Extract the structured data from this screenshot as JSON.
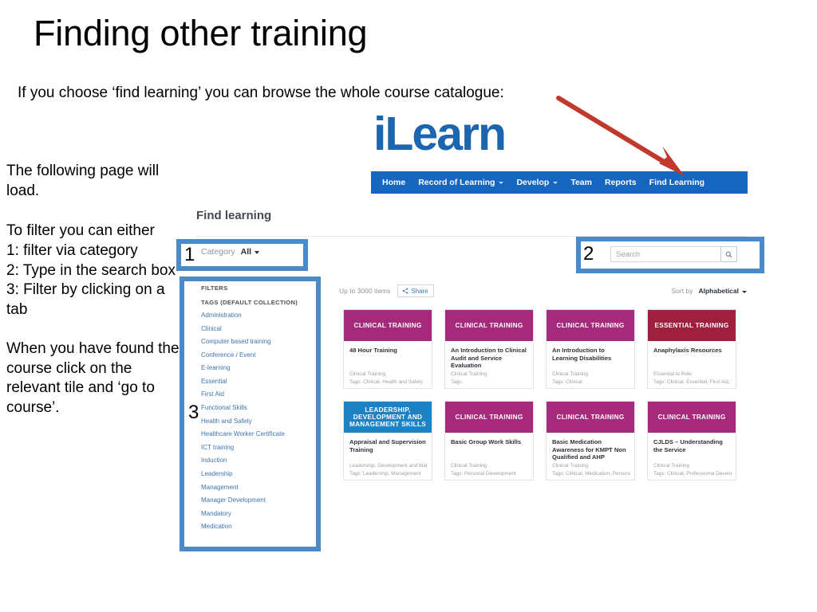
{
  "slide": {
    "title": "Finding other training",
    "intro": "If you choose ‘find learning’ you can browse the whole course catalogue:",
    "left_column": {
      "line1": "The following page will load.",
      "line2": "To filter you can either",
      "line3": "1: filter via category",
      "line4": "2: Type in the search box",
      "line5": "3: Filter by clicking on a tab",
      "line6": "When you have found the course click on the relevant tile and ‘go to course’."
    },
    "callouts": {
      "one": "1",
      "two": "2",
      "three": "3"
    },
    "highlight_color": "#4a89ca",
    "arrow_color": "#c0392b"
  },
  "ilearn": {
    "logo": "iLearn",
    "logo_color": "#1c66b0",
    "nav_bar_color": "#1665bf",
    "nav": [
      {
        "label": "Home",
        "caret": false
      },
      {
        "label": "Record of Learning",
        "caret": true
      },
      {
        "label": "Develop",
        "caret": true
      },
      {
        "label": "Team",
        "caret": false
      },
      {
        "label": "Reports",
        "caret": false
      },
      {
        "label": "Find Learning",
        "caret": false
      }
    ]
  },
  "find_learning": {
    "page_title": "Find learning",
    "category": {
      "label": "Category",
      "value": "All"
    },
    "search": {
      "placeholder": "Search",
      "value": "",
      "icon": "search-icon"
    },
    "filters": {
      "heading": "FILTERS",
      "subheading": "TAGS  (DEFAULT COLLECTION)",
      "tags": [
        "Administration",
        "Clinical",
        "Computer based training",
        "Conference / Event",
        "E-learning",
        "Essential",
        "First Aid",
        "Functional Skills",
        "Health and Safety",
        "Healthcare Worker Certificate",
        "ICT training",
        "Induction",
        "Leadership",
        "Management",
        "Manager Development",
        "Mandatory",
        "Medication"
      ]
    },
    "results_toolbar": {
      "items_count": "Up to 3000 items",
      "share_label": "Share",
      "share_icon": "share-icon",
      "sort_label": "Sort by",
      "sort_value": "Alphabetical"
    },
    "banner_colors": {
      "clinical": "#a62a7b",
      "essential": "#9e1f3e",
      "leadership": "#1c82c4"
    },
    "cards": [
      {
        "banner": "CLINICAL TRAINING",
        "banner_color": "#a62a7b",
        "title": "48 Hour Training",
        "meta": "Clinical Training",
        "tags": "Tags: Clinical, Health and Safety"
      },
      {
        "banner": "CLINICAL TRAINING",
        "banner_color": "#a62a7b",
        "title": "An Introduction to Clinical Audit and Service Evaluation",
        "meta": "Clinical Training",
        "tags": "Tags:"
      },
      {
        "banner": "CLINICAL TRAINING",
        "banner_color": "#a62a7b",
        "title": "An Introduction to Learning Disabilities",
        "meta": "Clinical Training",
        "tags": "Tags: Clinical"
      },
      {
        "banner": "ESSENTIAL TRAINING",
        "banner_color": "#9e1f3e",
        "title": "Anaphylaxis Resources",
        "meta": "Essential to Role",
        "tags": "Tags: Clinical, Essential, First Aid, Me..."
      },
      {
        "banner": "LEADERSHIP, DEVELOPMENT AND MANAGEMENT SKILLS",
        "banner_color": "#1c82c4",
        "title": "Appraisal and Supervision Training",
        "meta": "Leadership, Development and Mana...",
        "tags": "Tags: Leadership, Management"
      },
      {
        "banner": "CLINICAL TRAINING",
        "banner_color": "#a62a7b",
        "title": "Basic Group Work Skills",
        "meta": "Clinical Training",
        "tags": "Tags: Personal Development"
      },
      {
        "banner": "CLINICAL TRAINING",
        "banner_color": "#a62a7b",
        "title": "Basic Medication Awareness for KMPT Non Qualified and AHP",
        "meta": "Clinical Training",
        "tags": "Tags: Clinical, Medication, Personal ..."
      },
      {
        "banner": "CLINICAL TRAINING",
        "banner_color": "#a62a7b",
        "title": "CJLDS – Understanding the Service",
        "meta": "Clinical Training",
        "tags": "Tags: Clinical, Professional Develop..."
      }
    ]
  }
}
